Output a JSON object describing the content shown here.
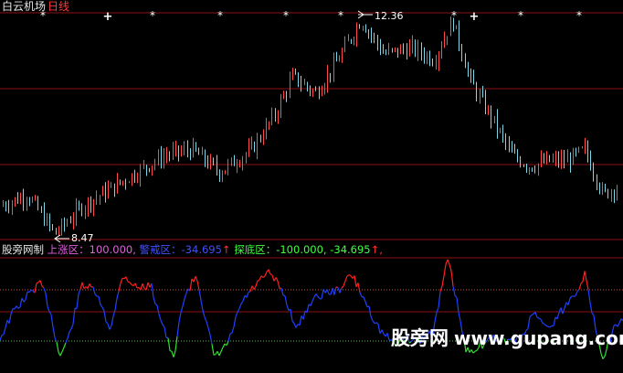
{
  "header": {
    "name": "白云机场",
    "period": "日线"
  },
  "price_panel": {
    "high_label": "12.36",
    "low_label": "8.47",
    "marker_stars": [
      "*",
      "*",
      "*",
      "*",
      "*",
      "*",
      "*",
      "*"
    ],
    "marker_crosses": [
      "+",
      "+"
    ]
  },
  "indicator": {
    "name": "股旁网制",
    "rise_label": "上涨区：",
    "rise_value": "100.000,",
    "watch_label": "警戒区：",
    "watch_value": "-34.695",
    "watch_arrow": "↑",
    "bottom_label": "探底区：",
    "bottom_value": "-100.000, -34.695",
    "bottom_arrow": "↑,"
  },
  "watermark": {
    "cn": "股旁网",
    "url": "www.gupang.com"
  },
  "colors": {
    "up": "#ff4a4a",
    "down": "#7fd6e6",
    "grid": "#8b1010",
    "line_blue": "#2040ff",
    "line_red": "#ff2020",
    "line_green": "#30e030",
    "rise_text": "#e060e0",
    "watch_text": "#4040ff",
    "bottom_text": "#40ff40",
    "warn_red": "#ff3030"
  },
  "chart_data": {
    "type": "candlestick",
    "price_high": 12.36,
    "price_low": 8.47,
    "indicator_levels": [
      100,
      -34.695,
      -100
    ]
  }
}
